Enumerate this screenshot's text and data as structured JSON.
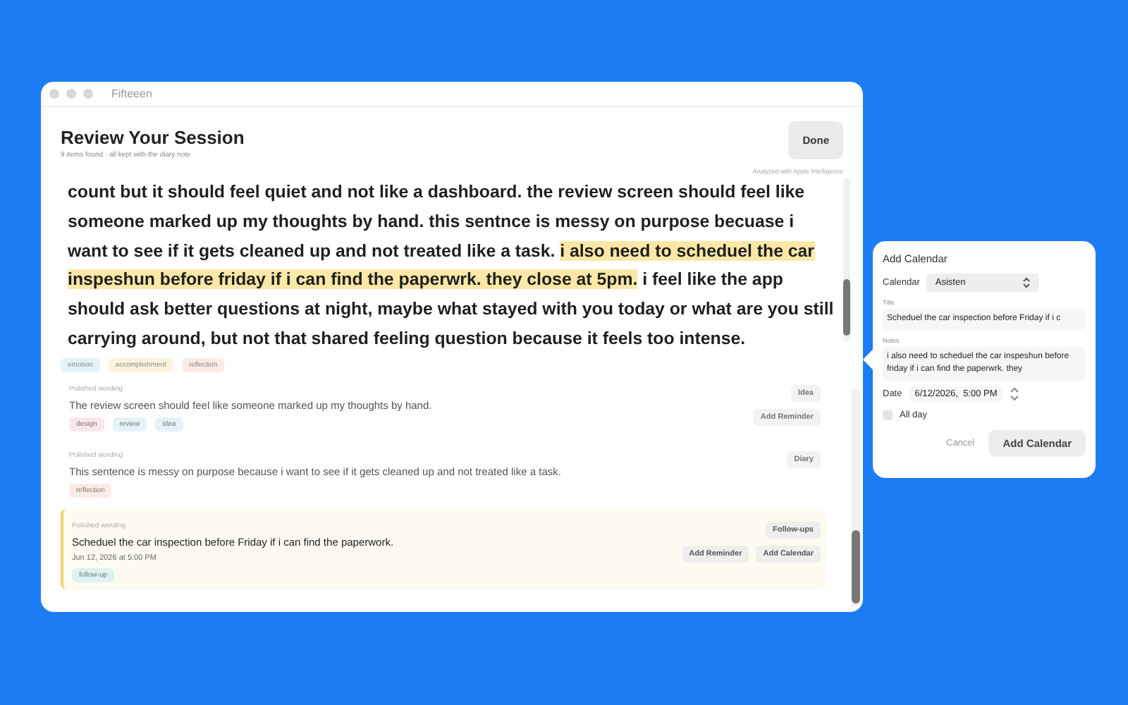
{
  "window": {
    "title": "Fifteeen"
  },
  "header": {
    "title": "Review Your Session",
    "subtitle": "9 items found · all kept with the diary note",
    "done_button": "Done"
  },
  "analysis_note": "Analyzed with Apple Intelligence",
  "transcript": [
    {
      "text": "count but it should feel quiet and not like a dashboard. the review screen should feel like someone marked up my thoughts by hand. this sentnce is messy on purpose becuase i want to see if it gets cleaned up and not treated like a task. ",
      "highlighted": false
    },
    {
      "text": "i also need to scheduel the car inspeshun before friday if i can find the paperwrk. they close at 5pm.",
      "highlighted": true
    },
    {
      "text": " i feel like the app should ask better questions at night, maybe what stayed with you today or what are you still carrying around, but not that shared feeling question because it feels too intense.",
      "highlighted": false
    }
  ],
  "faded_tags": [
    {
      "label": "emotion",
      "color": "#e3f3f8"
    },
    {
      "label": "accomplishment",
      "color": "#fdf3dc"
    },
    {
      "label": "reflection",
      "color": "#fbebe6"
    }
  ],
  "items": [
    {
      "label": "Polished wording",
      "text": "The review screen should feel like someone marked up my thoughts by hand.",
      "tags": [
        {
          "label": "design",
          "color": "#fbe6ea"
        },
        {
          "label": "review",
          "color": "#e3f3f8"
        },
        {
          "label": "idea",
          "color": "#e3f3f8"
        }
      ],
      "category": "Idea",
      "actions": [
        "Add Reminder"
      ],
      "highlighted": false
    },
    {
      "label": "Polished wording",
      "text": "This sentence is messy on purpose because i want to see if it gets cleaned up and not treated like a task.",
      "tags": [
        {
          "label": "reflection",
          "color": "#fbebe6"
        }
      ],
      "category": "Diary",
      "highlighted": false
    },
    {
      "label": "Polished wording",
      "text": "Scheduel the car inspection before Friday if i can find the paperwork.",
      "date": "Jun 12, 2026 at 5:00 PM",
      "tags": [
        {
          "label": "follow-up",
          "color": "#dcf2f2"
        }
      ],
      "category": "Follow-ups",
      "actions": [
        "Add Reminder",
        "Add Calendar"
      ],
      "highlighted": true
    }
  ],
  "popover": {
    "title": "Add Calendar",
    "calendar_label": "Calendar",
    "calendar_value": "Asisten",
    "title_label": "Title",
    "title_value": "Scheduel the car inspection before Friday if i c",
    "notes_label": "Notes",
    "notes_value": "i also need to scheduel the car inspeshun before friday if i can find the paperwrk. they",
    "date_label": "Date",
    "date_value": "6/12/2026,  5:00 PM",
    "all_day": {
      "label": "All day",
      "checked": false
    },
    "cancel_button": "Cancel",
    "add_button": "Add Calendar"
  }
}
